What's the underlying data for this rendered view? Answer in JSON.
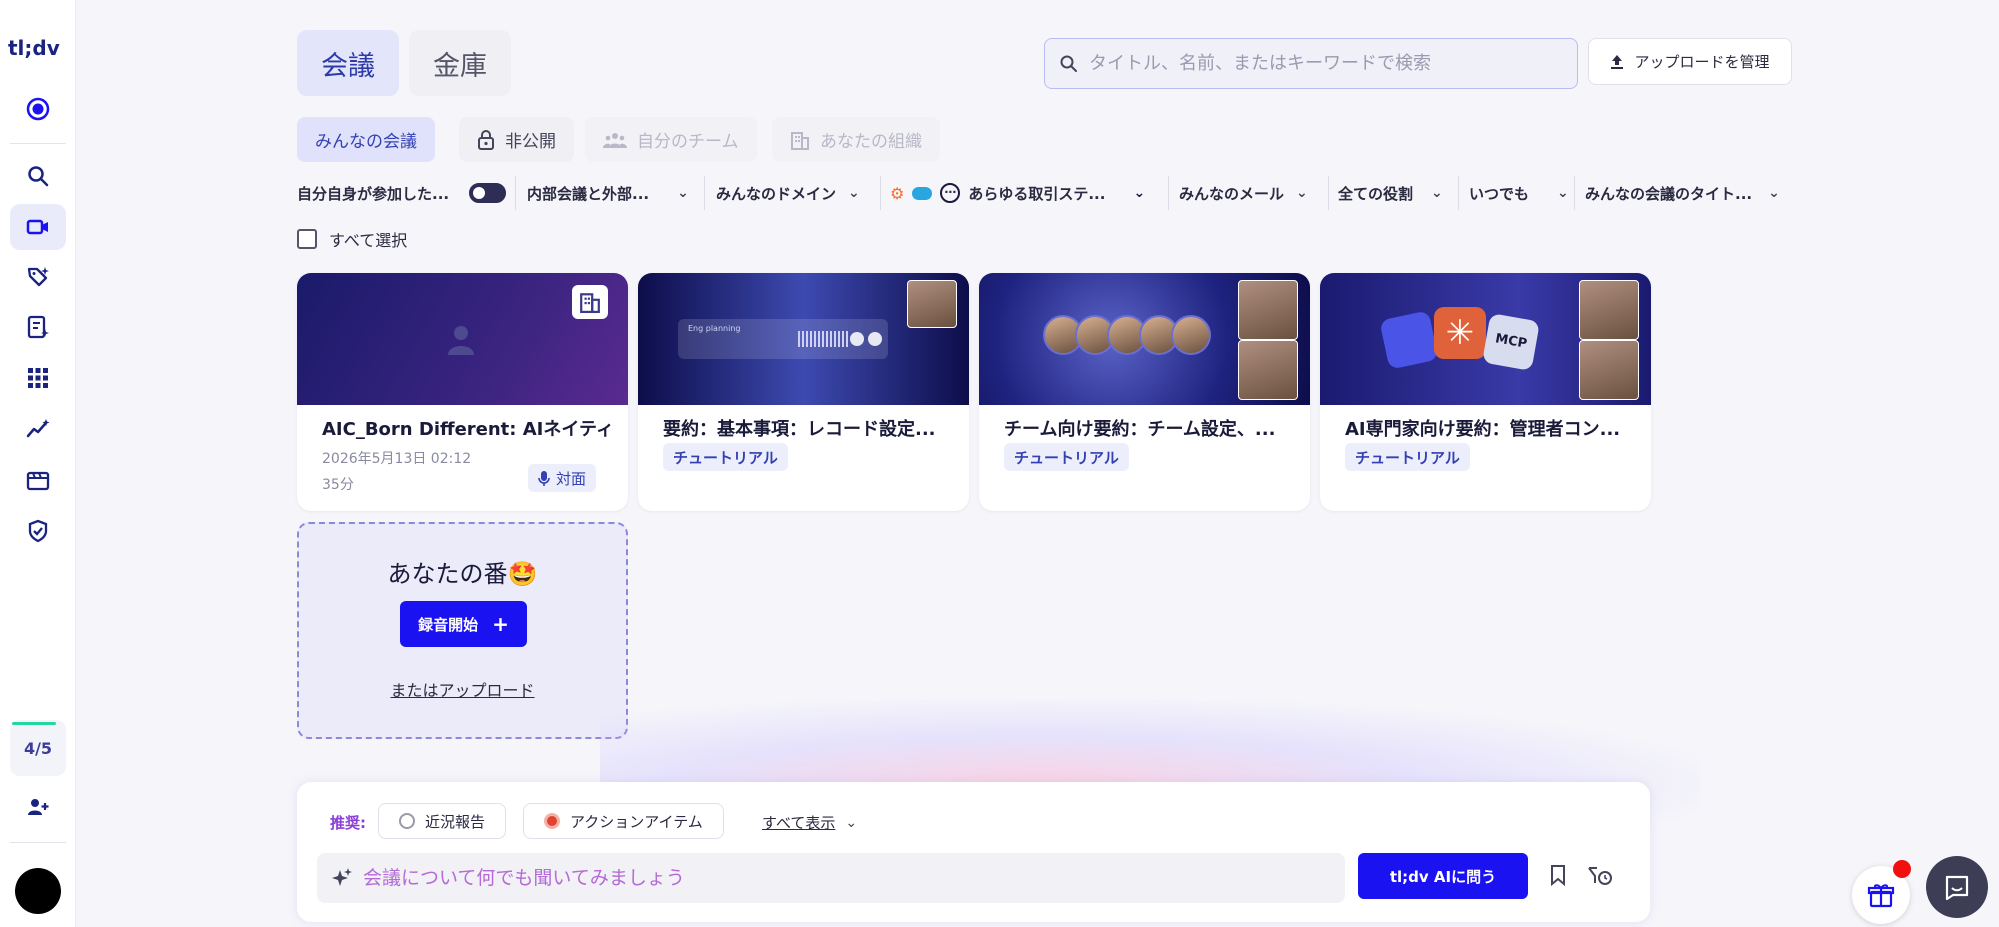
{
  "app": {
    "logo": "tl;dv",
    "usage": "4/5"
  },
  "main_tabs": [
    {
      "label": "会議"
    },
    {
      "label": "金庫"
    }
  ],
  "search": {
    "placeholder": "タイトル、名前、またはキーワードで検索"
  },
  "manage_upload_label": "アップロードを管理",
  "sub_tabs": [
    {
      "label": "みんなの会議"
    },
    {
      "label": "非公開"
    },
    {
      "label": "自分のチーム"
    },
    {
      "label": "あなたの組織"
    }
  ],
  "filters": {
    "self_attended": "自分自身が参加した...",
    "internal_external": "内部会議と外部...",
    "domain": "みんなのドメイン",
    "deal_stage": "あらゆる取引ステ...",
    "email": "みんなのメール",
    "role": "全ての役割",
    "time": "いつでも",
    "title": "みんなの会議のタイト..."
  },
  "select_all_label": "すべて選択",
  "meetings": [
    {
      "title": "AIC_Born Different: AIネイティ...",
      "date": "2026年5月13日 02:12",
      "duration": "35分",
      "type": "対面"
    },
    {
      "title": "要約：基本事項：レコード設定...",
      "badge": "チュートリアル",
      "thumb_text": "Eng planning"
    },
    {
      "title": "チーム向け要約：チーム設定、...",
      "badge": "チュートリアル"
    },
    {
      "title": "AI専門家向け要約：管理者コン...",
      "badge": "チュートリアル",
      "thumb_text": "MCP"
    }
  ],
  "your_turn": {
    "title": "あなたの番🤩",
    "record_label": "録音開始",
    "upload_label": "またはアップロード"
  },
  "ai": {
    "suggest_label": "推奨:",
    "chips": [
      {
        "label": "近況報告"
      },
      {
        "label": "アクションアイテム"
      }
    ],
    "show_all": "すべて表示",
    "input_placeholder": "会議について何でも聞いてみましょう",
    "ask_label": "tl;dv AIに問う"
  },
  "colors": {
    "brand": "#1a12f0",
    "accent_tab": "#e3e5fb",
    "notification": "#f20f0f"
  }
}
